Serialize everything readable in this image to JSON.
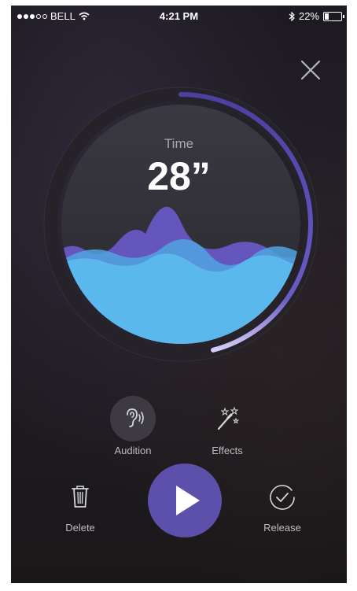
{
  "status_bar": {
    "carrier": "BELL",
    "time": "4:21 PM",
    "battery": "22%",
    "battery_level": 0.22,
    "signal_bars_filled": 3,
    "signal_bars_total": 5,
    "icons": [
      "signal-dots-icon",
      "wifi-icon",
      "bluetooth-icon",
      "battery-icon"
    ]
  },
  "header": {
    "close_icon": "close-icon"
  },
  "timer": {
    "label": "Time",
    "value": "28”",
    "progress": 0.46,
    "colors": {
      "progress_arc": "#5a4db0",
      "wave_front": "#5ab8ec",
      "wave_back": "#6a5cc0"
    }
  },
  "actions": {
    "audition_label": "Audition",
    "effects_label": "Effects",
    "delete_label": "Delete",
    "release_label": "Release",
    "icons": {
      "audition": "ear-sound-icon",
      "effects": "magic-wand-icon",
      "delete": "trash-icon",
      "play": "play-icon",
      "release": "check-circle-icon"
    }
  },
  "colors": {
    "accent": "#5d50ab",
    "background": "#1f1c22",
    "text_primary": "#ffffff",
    "text_secondary": "#bcbbc4"
  }
}
